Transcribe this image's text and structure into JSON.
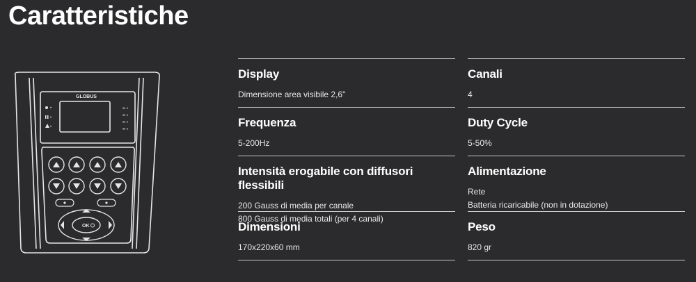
{
  "page": {
    "title": "Caratteristiche"
  },
  "device": {
    "brand": "GLOBUS",
    "ok_label": "OK"
  },
  "specs_left": [
    {
      "label": "Display",
      "values": [
        "Dimensione area visibile 2,6\""
      ]
    },
    {
      "label": "Frequenza",
      "values": [
        "5-200Hz"
      ]
    },
    {
      "label": "Intensità erogabile con diffusori flessibili",
      "values": [
        "200 Gauss di media per canale",
        "800 Gauss di media totali (per 4 canali)"
      ]
    },
    {
      "label": "Dimensioni",
      "values": [
        "170x220x60 mm"
      ]
    }
  ],
  "specs_right": [
    {
      "label": "Canali",
      "values": [
        "4"
      ]
    },
    {
      "label": "Duty Cycle",
      "values": [
        "5-50%"
      ]
    },
    {
      "label": "Alimentazione",
      "values": [
        "Rete",
        "Batteria ricaricabile (non in dotazione)"
      ]
    },
    {
      "label": "Peso",
      "values": [
        "820 gr"
      ]
    }
  ],
  "colors": {
    "background": "#2b2b2d",
    "text": "#ffffff",
    "rule": "#c9c9c9"
  }
}
